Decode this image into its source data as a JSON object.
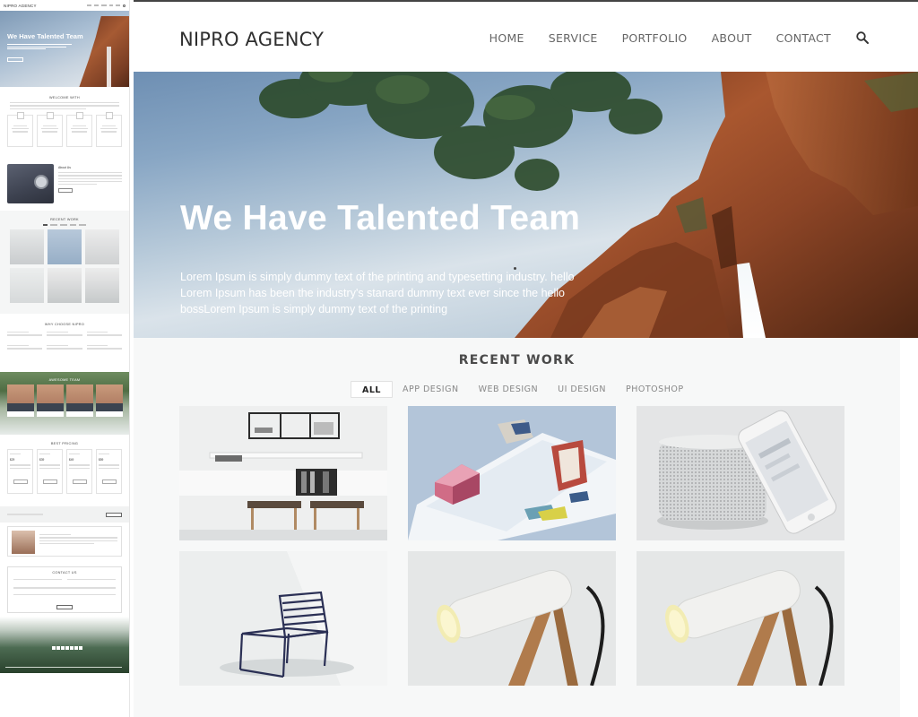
{
  "thumbnail": {
    "brand": "NIPRO AGENCY",
    "hero_title": "We Have Talented Team",
    "welcome_heading": "WELCOME WITH",
    "about_heading": "About Us",
    "recent_heading": "RECENT WORK",
    "why_heading": "WHY CHOOSE NIPRO",
    "team_heading": "AWESOME TEAM",
    "pricing_heading": "BEST PRICING",
    "prices": [
      "$29",
      "$39",
      "$49",
      "$59"
    ],
    "contact_heading": "CONTACT US"
  },
  "header": {
    "brand": "NIPRO AGENCY",
    "nav": [
      "HOME",
      "SERVICE",
      "PORTFOLIO",
      "ABOUT",
      "CONTACT"
    ],
    "search_icon": "search-icon"
  },
  "hero": {
    "title": "We Have Talented Team",
    "text": "Lorem Ipsum is simply dummy text of the printing and typesetting industry. hello Lorem Ipsum has been the industry's stanard dummy text ever since the hello bossLorem Ipsum is simply dummy text of the printing"
  },
  "recent_work": {
    "title": "RECENT WORK",
    "filters": [
      "ALL",
      "APP DESIGN",
      "WEB DESIGN",
      "UI DESIGN",
      "PHOTOSHOP"
    ],
    "active_filter": "ALL",
    "items": [
      {
        "subject": "shelf-with-stools"
      },
      {
        "subject": "paper-house-model"
      },
      {
        "subject": "speaker-and-phone"
      },
      {
        "subject": "wire-chair"
      },
      {
        "subject": "desk-lamp"
      },
      {
        "subject": "desk-lamp"
      }
    ]
  },
  "colors": {
    "text_dark": "#2f2f2f",
    "nav_text": "#666666",
    "section_bg": "#f7f8f8",
    "rock": "#9c4f2d",
    "sky": "#88a6c4"
  }
}
